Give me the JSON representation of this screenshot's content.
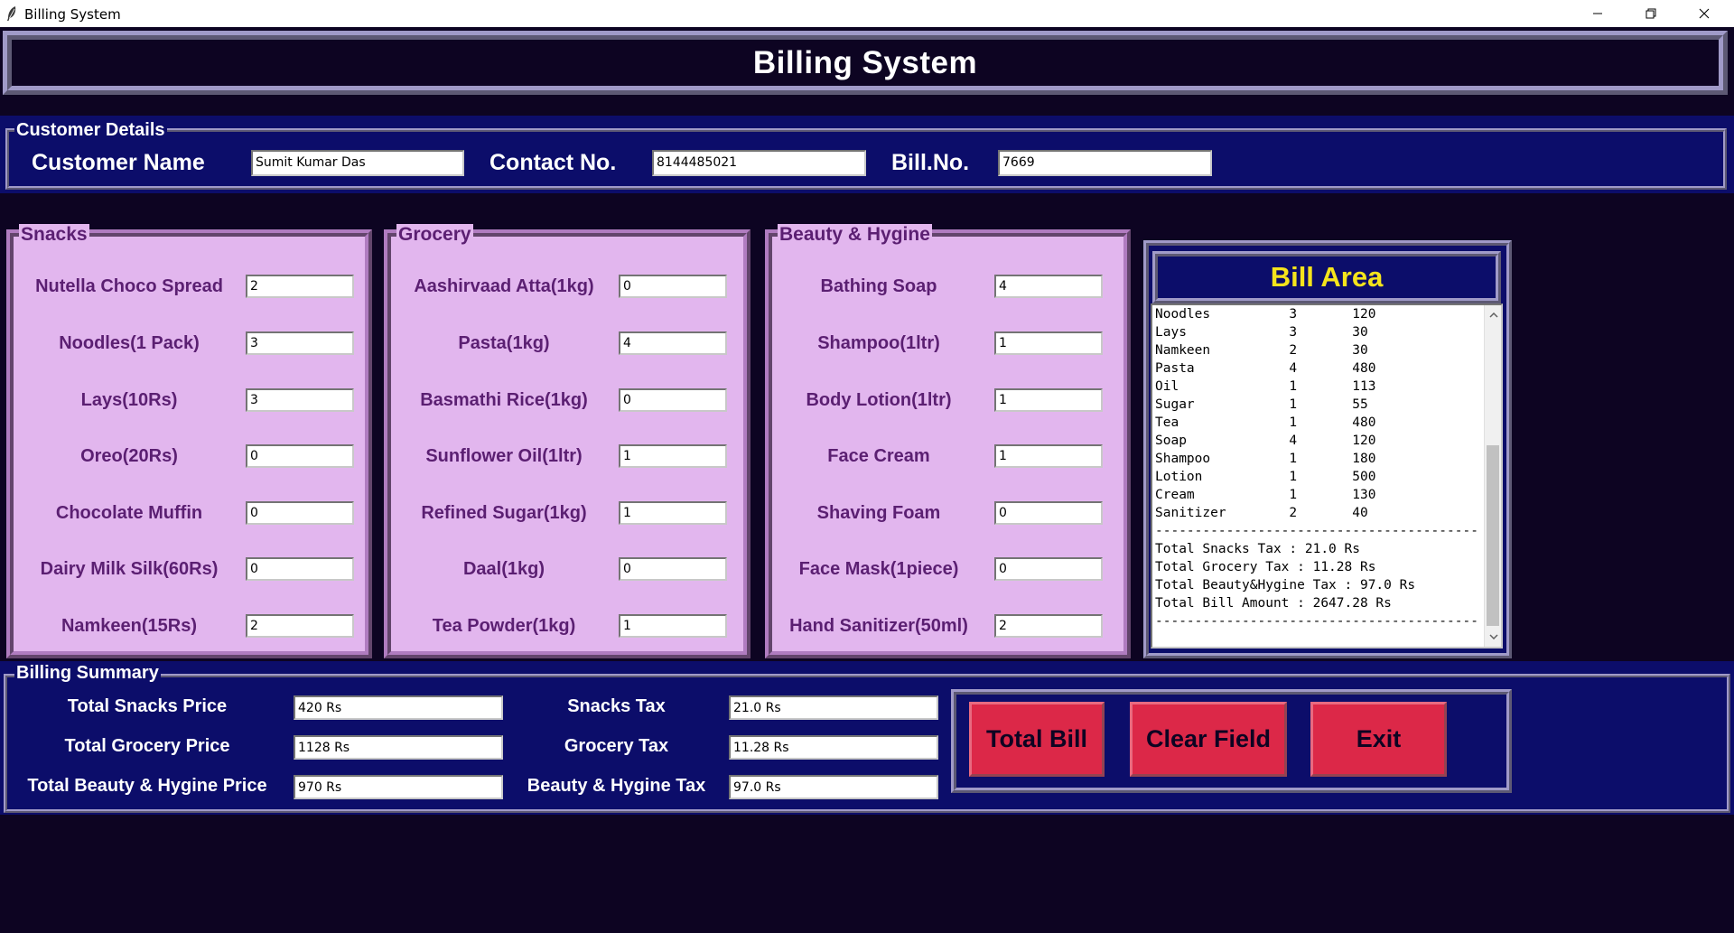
{
  "window": {
    "title": "Billing System",
    "minimize_glyph": "—",
    "restore_glyph": "❐",
    "close_glyph": "✕"
  },
  "header": {
    "title": "Billing System"
  },
  "customer": {
    "legend": "Customer Details",
    "name_label": "Customer Name",
    "name_value": "Sumit Kumar Das",
    "contact_label": "Contact No.",
    "contact_value": "8144485021",
    "bill_label": "Bill.No.",
    "bill_value": "7669"
  },
  "snacks": {
    "legend": "Snacks",
    "items": [
      {
        "label": "Nutella Choco Spread",
        "qty": "2"
      },
      {
        "label": "Noodles(1 Pack)",
        "qty": "3"
      },
      {
        "label": "Lays(10Rs)",
        "qty": "3"
      },
      {
        "label": "Oreo(20Rs)",
        "qty": "0"
      },
      {
        "label": "Chocolate Muffin",
        "qty": "0"
      },
      {
        "label": "Dairy Milk Silk(60Rs)",
        "qty": "0"
      },
      {
        "label": "Namkeen(15Rs)",
        "qty": "2"
      }
    ]
  },
  "grocery": {
    "legend": "Grocery",
    "items": [
      {
        "label": "Aashirvaad Atta(1kg)",
        "qty": "0"
      },
      {
        "label": "Pasta(1kg)",
        "qty": "4"
      },
      {
        "label": "Basmathi Rice(1kg)",
        "qty": "0"
      },
      {
        "label": "Sunflower Oil(1ltr)",
        "qty": "1"
      },
      {
        "label": "Refined Sugar(1kg)",
        "qty": "1"
      },
      {
        "label": "Daal(1kg)",
        "qty": "0"
      },
      {
        "label": "Tea Powder(1kg)",
        "qty": "1"
      }
    ]
  },
  "beauty": {
    "legend": "Beauty & Hygine",
    "items": [
      {
        "label": "Bathing Soap",
        "qty": "4"
      },
      {
        "label": "Shampoo(1ltr)",
        "qty": "1"
      },
      {
        "label": "Body Lotion(1ltr)",
        "qty": "1"
      },
      {
        "label": "Face Cream",
        "qty": "1"
      },
      {
        "label": "Shaving Foam",
        "qty": "0"
      },
      {
        "label": "Face Mask(1piece)",
        "qty": "0"
      },
      {
        "label": "Hand Sanitizer(50ml)",
        "qty": "2"
      }
    ]
  },
  "bill_area": {
    "title": "Bill Area",
    "text": "Noodles          3       120\nLays             3       30\nNamkeen          2       30\nPasta            4       480\nOil              1       113\nSugar            1       55\nTea              1       480\nSoap             4       120\nShampoo          1       180\nLotion           1       500\nCream            1       130\nSanitizer        2       40\n-----------------------------------------\nTotal Snacks Tax : 21.0 Rs\nTotal Grocery Tax : 11.28 Rs\nTotal Beauty&Hygine Tax : 97.0 Rs\nTotal Bill Amount : 2647.28 Rs\n-----------------------------------------"
  },
  "summary": {
    "legend": "Billing Summary",
    "snacks_price_label": "Total Snacks Price",
    "snacks_price_value": "420 Rs",
    "grocery_price_label": "Total Grocery Price",
    "grocery_price_value": "1128 Rs",
    "beauty_price_label": "Total Beauty & Hygine Price",
    "beauty_price_value": "970 Rs",
    "snacks_tax_label": "Snacks Tax",
    "snacks_tax_value": "21.0 Rs",
    "grocery_tax_label": "Grocery Tax",
    "grocery_tax_value": "11.28 Rs",
    "beauty_tax_label": "Beauty & Hygine Tax",
    "beauty_tax_value": "97.0 Rs"
  },
  "buttons": {
    "total": "Total Bill",
    "clear": "Clear Field",
    "exit": "Exit"
  },
  "colors": {
    "background": "#0d0422",
    "panel_blue": "#0c0d6a",
    "panel_pink": "#e2b6ee",
    "item_text": "#5b1f72",
    "bill_title": "#f5e41c",
    "button": "#dc2848"
  }
}
